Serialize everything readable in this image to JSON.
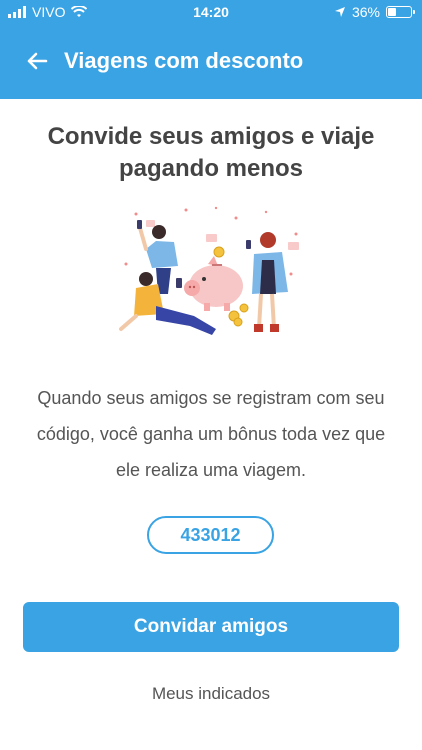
{
  "status_bar": {
    "carrier": "VIVO",
    "time": "14:20",
    "battery": "36%"
  },
  "header": {
    "title": "Viagens com desconto"
  },
  "main": {
    "headline": "Convide seus amigos e viaje pagando menos",
    "description": "Quando seus amigos se registram com seu código, você ganha um bônus toda vez que ele realiza uma viagem.",
    "referral_code": "433012",
    "invite_button": "Convidar amigos",
    "my_referrals_link": "Meus indicados"
  },
  "colors": {
    "primary": "#3aa3e3",
    "text": "#444444",
    "background": "#ffffff"
  },
  "icons": [
    "back-arrow-icon",
    "wifi-icon",
    "signal-icon",
    "location-arrow-icon",
    "battery-icon"
  ]
}
